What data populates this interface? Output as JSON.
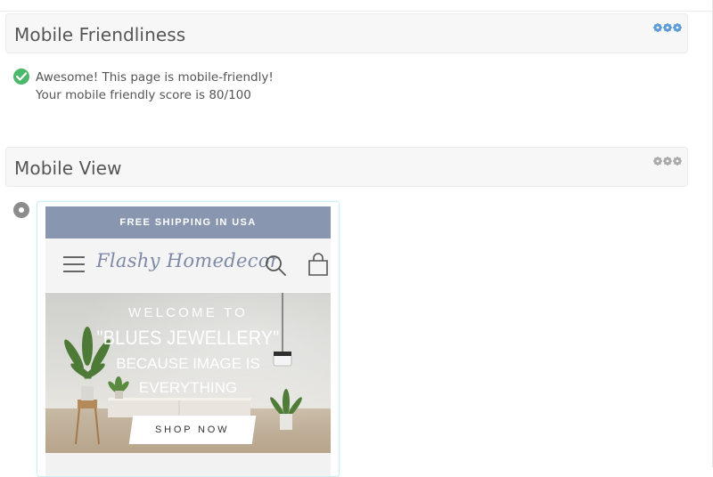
{
  "friendliness": {
    "title": "Mobile Friendliness",
    "result_line1": "Awesome! This page is mobile-friendly!",
    "result_line2": "Your mobile friendly score is 80/100",
    "status_icon": "check-circle-icon",
    "gear_color": "#5b9bd5"
  },
  "mobile_view": {
    "title": "Mobile View",
    "gear_color": "#a9a9a9",
    "preview": {
      "announcement": "FREE SHIPPING IN USA",
      "logo": "Flashy Homedecor",
      "hero_line1": "WELCOME TO",
      "hero_line2": "\"BLUES JEWELLERY\"",
      "hero_line3": "BECAUSE IMAGE IS",
      "hero_line4": "EVERYTHING",
      "cta": "SHOP NOW"
    }
  },
  "colors": {
    "check_green": "#4cb86b",
    "announce_bg": "#8896af",
    "logo_color": "#7d89a6"
  }
}
